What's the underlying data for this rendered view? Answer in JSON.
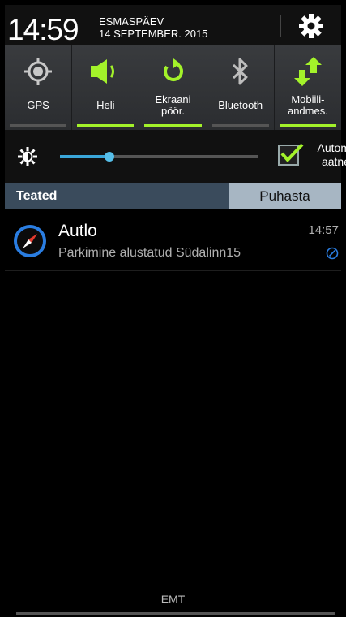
{
  "header": {
    "time": "14:59",
    "weekday": "ESMASPÄEV",
    "date": "14 SEPTEMBER. 2015",
    "settings_icon": "gear-icon"
  },
  "toggles": [
    {
      "label": "GPS",
      "icon": "gps-icon",
      "on": false
    },
    {
      "label": "Heli",
      "icon": "sound-icon",
      "on": true
    },
    {
      "label": "Ekraani\npöör.",
      "icon": "rotate-icon",
      "on": true
    },
    {
      "label": "Bluetooth",
      "icon": "bluetooth-icon",
      "on": false
    },
    {
      "label": "Mobiili-\nandmes.",
      "icon": "mobile-data-icon",
      "on": true
    }
  ],
  "brightness": {
    "level": 0.25,
    "auto_label": "Autom\naatne",
    "auto_checked": true
  },
  "notifications": {
    "title": "Teated",
    "clear_label": "Puhasta",
    "items": [
      {
        "app": "Autlo",
        "message": "Parkimine alustatud Südalinn15",
        "time": "14:57",
        "icon": "compass-icon"
      }
    ]
  },
  "footer": {
    "carrier": "EMT"
  },
  "colors": {
    "toggle_on": "#a3f22a",
    "toggle_off": "#555555",
    "accent_blue": "#2a7de1",
    "slider": "#3aa6d9"
  }
}
